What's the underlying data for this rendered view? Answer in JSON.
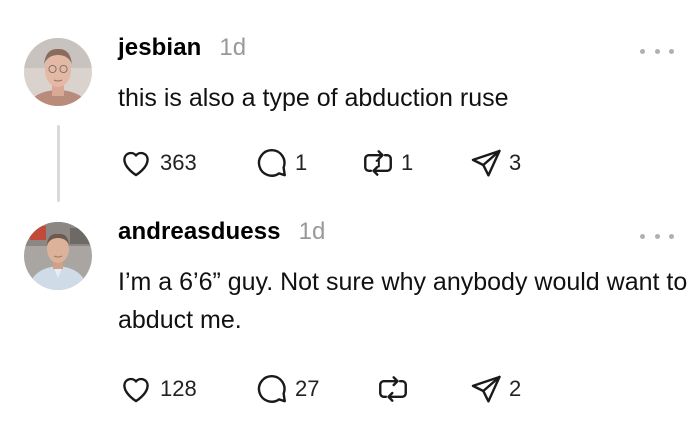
{
  "posts": [
    {
      "username": "jesbian",
      "time": "1d",
      "text": "this is also a type of abduction ruse",
      "likes": "363",
      "replies": "1",
      "reposts": "1",
      "shares": "3"
    },
    {
      "username": "andreasduess",
      "time": "1d",
      "text": "I’m a 6’6” guy. Not sure why anybody would want to abduct me.",
      "likes": "128",
      "replies": "27",
      "reposts": "",
      "shares": "2"
    }
  ],
  "icons": {
    "like": "heart-icon",
    "reply": "comment-icon",
    "repost": "repost-icon",
    "share": "send-icon",
    "more": "more-dots-icon"
  },
  "colors": {
    "username": "#000000",
    "timestamp": "#999999",
    "thread_line": "#d9d9d9",
    "icon": "#1a1a1a"
  }
}
